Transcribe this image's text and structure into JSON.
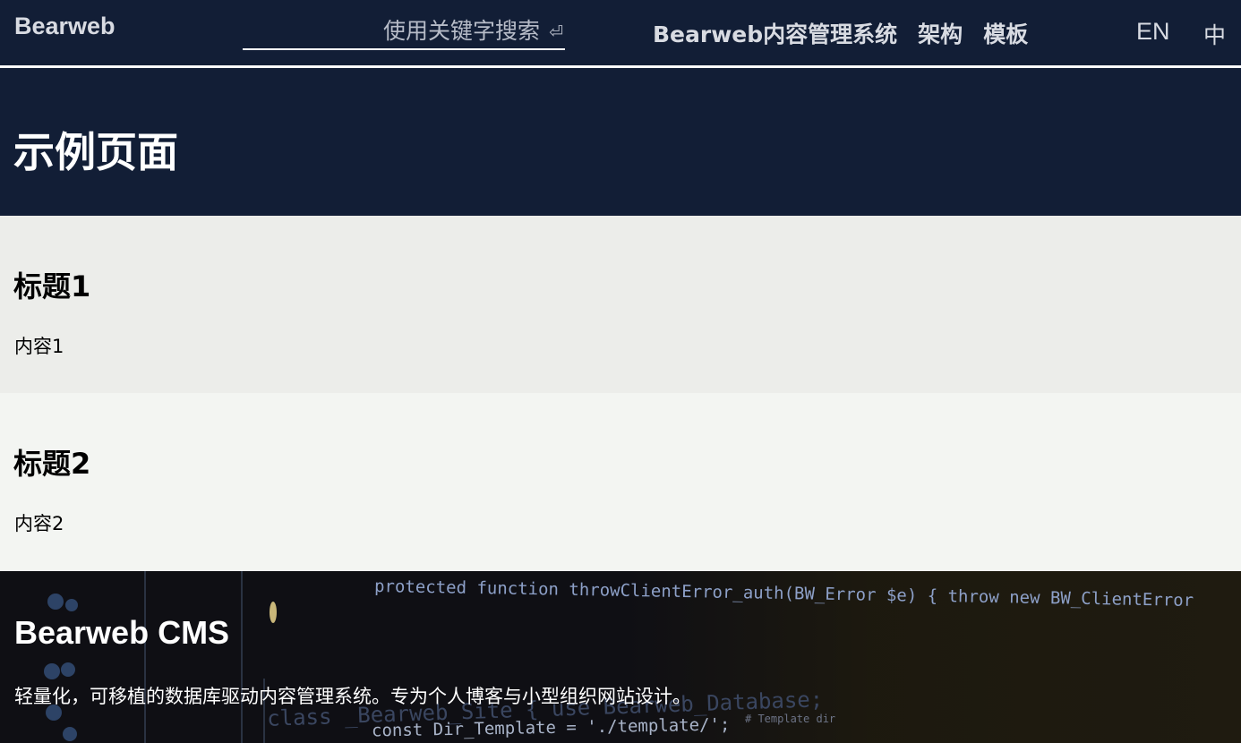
{
  "header": {
    "brand": "Bearweb",
    "search_placeholder": "使用关键字搜索",
    "search_icon": "enter-icon",
    "nav": [
      {
        "label": "Bearweb内容管理系统"
      },
      {
        "label": "架构"
      },
      {
        "label": "模板"
      }
    ],
    "lang_en": "EN",
    "lang_zh": "中"
  },
  "page": {
    "title": "示例页面"
  },
  "sections": [
    {
      "heading": "标题1",
      "content": "内容1"
    },
    {
      "heading": "标题2",
      "content": "内容2"
    }
  ],
  "footer": {
    "title": "Bearweb CMS",
    "description": "轻量化，可移植的数据库驱动内容管理系统。专为个人博客与小型组织网站设计。",
    "background_code": [
      "protected function throwClientError_auth(BW_Error $e) { throw new BW_ClientError",
      "class _Bearweb_Site { use Bearweb_Database;",
      "const Dir_Template = './template/';",
      "# Template dir"
    ]
  },
  "colors": {
    "header_bg": "#121e36",
    "section1_bg": "#ecedea",
    "section2_bg": "#f3f5f2",
    "footer_bg": "#0f0f14"
  }
}
